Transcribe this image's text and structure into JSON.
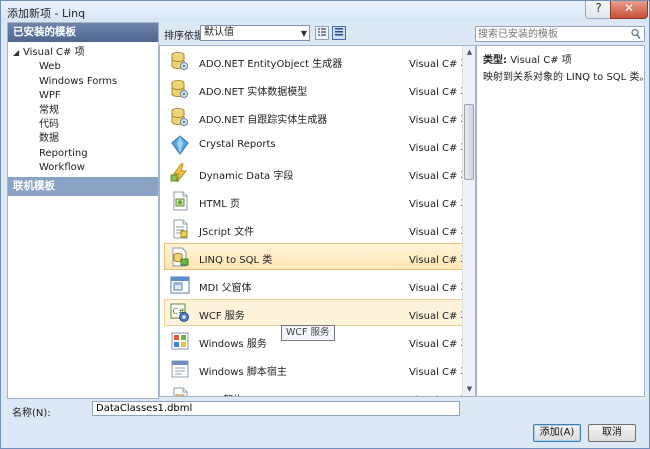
{
  "window": {
    "title": "添加新项 - Linq",
    "help_label": "?",
    "close_label": "✕"
  },
  "left": {
    "installed_header": "已安装的模板",
    "tree_root": "Visual C# 项",
    "tree_children": [
      "Web",
      "Windows Forms",
      "WPF",
      "常规",
      "代码",
      "数据",
      "Reporting",
      "Workflow"
    ],
    "online_header": "联机模板"
  },
  "toolbar": {
    "sort_label": "排序依据:",
    "sort_value": "默认值"
  },
  "search": {
    "placeholder": "搜索已安装的模板"
  },
  "templates": [
    {
      "name": "ADO.NET EntityObject 生成器",
      "type": "Visual C# 项",
      "icon": "database-cylinder-icon"
    },
    {
      "name": "ADO.NET 实体数据模型",
      "type": "Visual C# 项",
      "icon": "database-cylinder-icon"
    },
    {
      "name": "ADO.NET 自跟踪实体生成器",
      "type": "Visual C# 项",
      "icon": "database-cylinder-icon"
    },
    {
      "name": "Crystal Reports",
      "type": "Visual C# 项",
      "icon": "crystal-report-icon"
    },
    {
      "name": "Dynamic Data 字段",
      "type": "Visual C# 项",
      "icon": "dynamic-data-icon"
    },
    {
      "name": "HTML 页",
      "type": "Visual C# 项",
      "icon": "html-page-icon"
    },
    {
      "name": "JScript 文件",
      "type": "Visual C# 项",
      "icon": "script-file-icon"
    },
    {
      "name": "LINQ to SQL 类",
      "type": "Visual C# 项",
      "icon": "linq-to-sql-icon"
    },
    {
      "name": "MDI 父窗体",
      "type": "Visual C# 项",
      "icon": "mdi-form-icon"
    },
    {
      "name": "WCF 服务",
      "type": "Visual C# 项",
      "icon": "wcf-service-icon"
    },
    {
      "name": "Windows 服务",
      "type": "Visual C# 项",
      "icon": "windows-service-icon"
    },
    {
      "name": "Windows 脚本宿主",
      "type": "Visual C# 项",
      "icon": "script-host-icon"
    },
    {
      "name": "XML 架构",
      "type": "Visual C# 项",
      "icon": "xml-schema-icon"
    }
  ],
  "selected_index": 7,
  "tooltip": "WCF 服务",
  "info": {
    "type_label": "类型:",
    "type_value": "Visual C# 项",
    "description": "映射到关系对象的 LINQ to SQL 类。"
  },
  "name_field": {
    "label": "名称(N):",
    "value": "DataClasses1.dbml"
  },
  "buttons": {
    "add": "添加(A)",
    "cancel": "取消"
  },
  "colors": {
    "header": "#4e6690",
    "selection": "#fde6b3",
    "window_bg": "#dde8f5"
  }
}
